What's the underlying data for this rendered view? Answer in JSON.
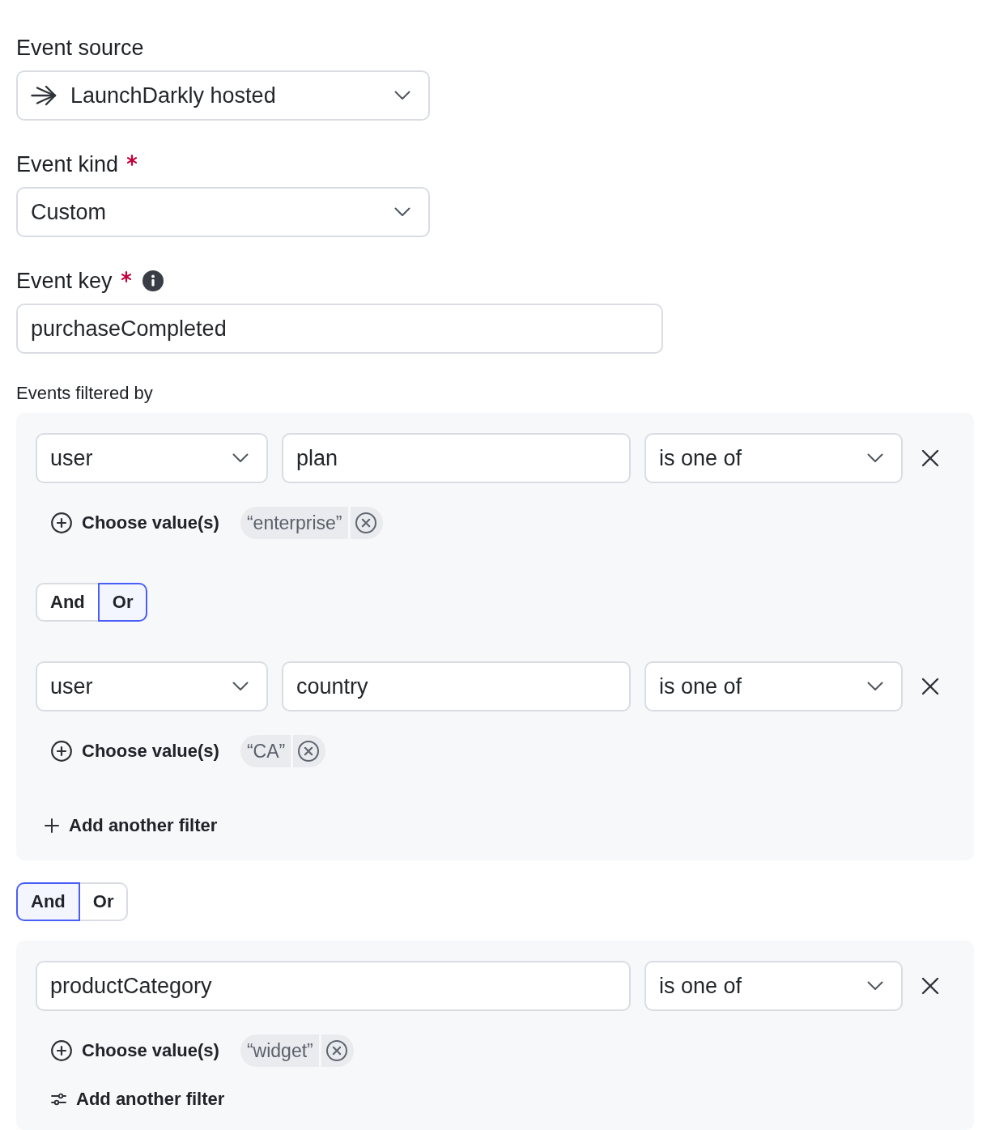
{
  "event_source": {
    "label": "Event source",
    "value": "LaunchDarkly hosted"
  },
  "event_kind": {
    "label": "Event kind",
    "required": true,
    "value": "Custom"
  },
  "event_key": {
    "label": "Event key",
    "required": true,
    "help": true,
    "value": "purchaseCompleted"
  },
  "filters": {
    "label": "Events filtered by",
    "items": [
      {
        "kind": "group",
        "items": [
          {
            "kind": "rule",
            "context": "user",
            "attribute": "plan",
            "operator": "is one of",
            "choose_label": "Choose value(s)",
            "values": [
              "“enterprise”"
            ]
          },
          {
            "kind": "toggle",
            "options": [
              {
                "label": "And",
                "selected": false
              },
              {
                "label": "Or",
                "selected": true
              }
            ]
          },
          {
            "kind": "rule",
            "context": "user",
            "attribute": "country",
            "operator": "is one of",
            "choose_label": "Choose value(s)",
            "values": [
              "“CA”"
            ]
          },
          {
            "kind": "add",
            "label": "Add another filter"
          }
        ]
      },
      {
        "kind": "toggle",
        "options": [
          {
            "label": "And",
            "selected": true
          },
          {
            "label": "Or",
            "selected": false
          }
        ]
      },
      {
        "kind": "group",
        "items": [
          {
            "kind": "rule",
            "attribute": "productCategory",
            "operator": "is one of",
            "choose_label": "Choose value(s)",
            "values": [
              "“widget”"
            ]
          },
          {
            "kind": "configure",
            "label": "Add another filter"
          }
        ]
      }
    ]
  }
}
